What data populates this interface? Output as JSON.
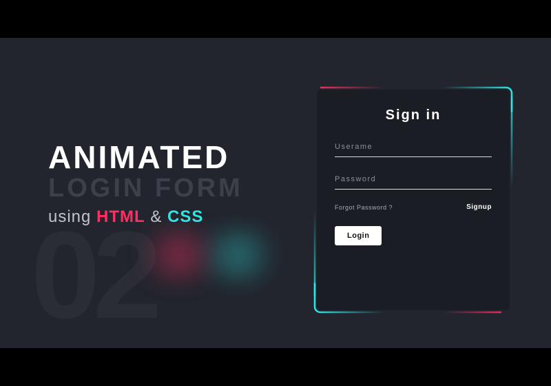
{
  "hero": {
    "bg_number": "02",
    "line1": "ANIMATED",
    "line2": "LOGIN FORM",
    "line3_prefix": "using ",
    "line3_html": "HTML",
    "line3_amp": " & ",
    "line3_css": "CSS"
  },
  "form": {
    "title": "Sign in",
    "username_label": "Userame",
    "password_label": "Password",
    "forgot_label": "Forgot Password ?",
    "signup_label": "Signup",
    "login_label": "Login"
  },
  "colors": {
    "accent_pink": "#ff2e63",
    "accent_cyan": "#2ee6e6",
    "bg_stage": "#22252d",
    "bg_card": "#1b1d24"
  }
}
